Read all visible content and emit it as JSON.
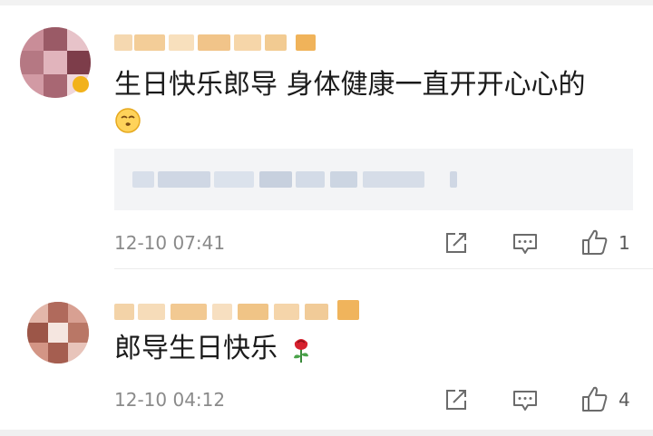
{
  "comments": [
    {
      "text": "生日快乐郎导 身体健康一直开开心心的",
      "emoji": "kissing-smiling-eyes-emoji",
      "timestamp": "12-10 07:41",
      "likes": "1"
    },
    {
      "text": "郎导生日快乐",
      "emoji": "rose-emoji",
      "timestamp": "12-10 04:12",
      "likes": "4"
    }
  ],
  "icons": {
    "share": "share-icon",
    "reply": "comment-icon",
    "like": "thumbs-up-icon"
  },
  "colors": {
    "text": "#1a1a1a",
    "meta": "#8a8a8a",
    "icon": "#6b6b6b",
    "quote_bg": "#f3f4f6"
  }
}
